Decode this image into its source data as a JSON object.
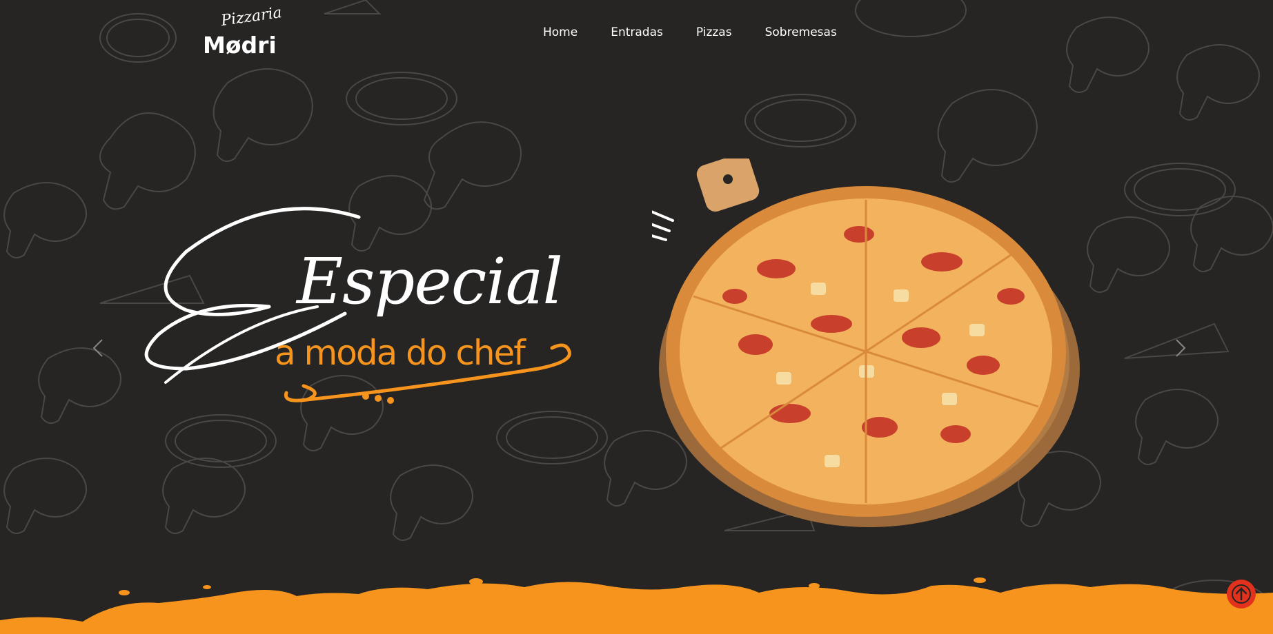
{
  "brand": {
    "script": "Pizzaria",
    "name": "Mødri"
  },
  "nav": {
    "items": [
      {
        "label": "Home"
      },
      {
        "label": "Entradas"
      },
      {
        "label": "Pizzas"
      },
      {
        "label": "Sobremesas"
      }
    ]
  },
  "hero": {
    "title_script": "Especial",
    "subtitle": "a moda do chef",
    "image_subject": "pizza on wooden board"
  },
  "carousel": {
    "prev_icon": "chevron-left-icon",
    "next_icon": "chevron-right-icon"
  },
  "scroll_top": {
    "icon": "arrow-up-icon"
  },
  "colors": {
    "background": "#262524",
    "accent_orange": "#f7941d",
    "button_red": "#e2311d",
    "text": "#ffffff",
    "pattern_line": "#4a4744"
  }
}
